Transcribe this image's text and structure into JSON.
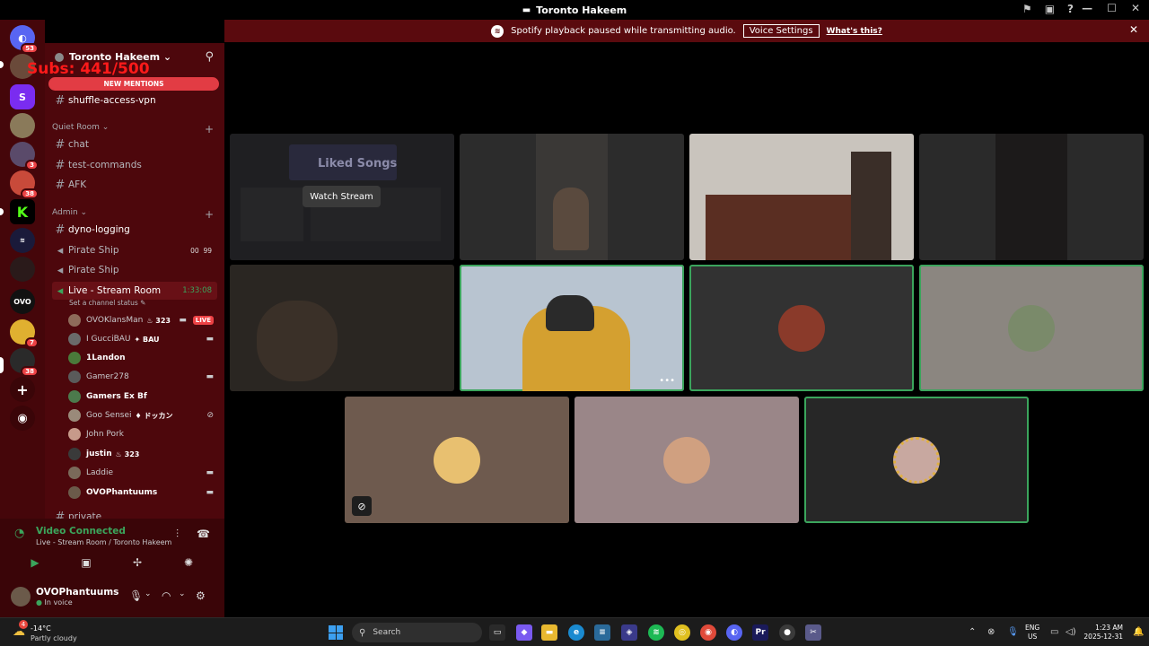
{
  "window": {
    "title": "Toronto Hakeem"
  },
  "banner": {
    "message": "Spotify playback paused while transmitting audio.",
    "voice_settings": "Voice Settings",
    "whats_this": "What's this?"
  },
  "overlay": {
    "subs_text": "Subs: 441/500"
  },
  "servers": [
    {
      "icon": "discord-home-icon",
      "badge": "53"
    },
    {
      "icon": "avatar-server",
      "badge": ""
    },
    {
      "icon": "purple-server",
      "badge": ""
    },
    {
      "icon": "person-server",
      "badge": ""
    },
    {
      "icon": "group-server",
      "badge": "3"
    },
    {
      "icon": "mario-server",
      "badge": "38"
    },
    {
      "icon": "kick-server",
      "badge": ""
    },
    {
      "icon": "logo-server",
      "badge": ""
    },
    {
      "icon": "dark-server",
      "badge": ""
    },
    {
      "icon": "ovo-server",
      "badge": ""
    },
    {
      "icon": "simpsons-server",
      "badge": "7"
    },
    {
      "icon": "phantom-server",
      "badge": "38"
    }
  ],
  "server_name": "Toronto Hakeem",
  "new_mentions": "NEW MENTIONS",
  "channels_top": [
    {
      "name": "shuffle-access-vpn"
    }
  ],
  "categories": {
    "quiet_room": "Quiet Room",
    "admin": "Admin"
  },
  "quiet_channels": [
    {
      "name": "chat"
    },
    {
      "name": "test-commands"
    },
    {
      "name": "AFK"
    }
  ],
  "admin_channels": [
    {
      "name": "dyno-logging",
      "type": "text"
    },
    {
      "name": "Pirate Ship",
      "type": "voice",
      "count_a": "00",
      "count_b": "99"
    },
    {
      "name": "Pirate Ship",
      "type": "voice"
    }
  ],
  "live_channel": {
    "name": "Live - Stream Room",
    "time": "1:33:08",
    "status": "Set a channel status"
  },
  "members": [
    {
      "name": "OVOKlansMan",
      "tag": "323",
      "live": "LIVE",
      "color": "#8e6b5a"
    },
    {
      "name": "I GucciBAU",
      "tag": "BAU",
      "live": "",
      "color": "#6a6a6a"
    },
    {
      "name": "1Landon",
      "tag": "",
      "live": "",
      "color": "#4a7a3a"
    },
    {
      "name": "Gamer278",
      "tag": "",
      "live": "",
      "color": "#5a5a5a"
    },
    {
      "name": "Gamers Ex Bf",
      "tag": "",
      "live": "",
      "color": "#4c7a4c"
    },
    {
      "name": "Goo Sensei",
      "tag": "ドッカン",
      "live": "",
      "color": "#9a8a7a"
    },
    {
      "name": "John Pork",
      "tag": "",
      "live": "",
      "color": "#c79a8a"
    },
    {
      "name": "justin",
      "tag": "323",
      "live": "",
      "color": "#3a3a3a"
    },
    {
      "name": "Laddie",
      "tag": "",
      "live": "",
      "color": "#7a6a5a"
    },
    {
      "name": "OVOPhantuums",
      "tag": "",
      "live": "",
      "color": "#6b5a4a"
    }
  ],
  "private_channel": "private",
  "voice": {
    "title": "Video Connected",
    "subtitle": "Live - Stream Room / Toronto Hakeem"
  },
  "user": {
    "name": "OVOPhantuums",
    "status": "In voice"
  },
  "stage": {
    "watch_stream": "Watch Stream",
    "liked_songs": "Liked Songs"
  },
  "taskbar": {
    "search_placeholder": "Search",
    "weather_temp": "-14°C",
    "weather_desc": "Partly cloudy",
    "weather_badge": "4",
    "lang_1": "ENG",
    "lang_2": "US",
    "time": "1:23 AM",
    "date": "2025-12-31"
  },
  "colors": {
    "sidebar": "#4d070c",
    "server_bar": "#45060a",
    "banner": "#5a0a0e",
    "speaking": "#3ba55c",
    "live": "#ed4245"
  }
}
